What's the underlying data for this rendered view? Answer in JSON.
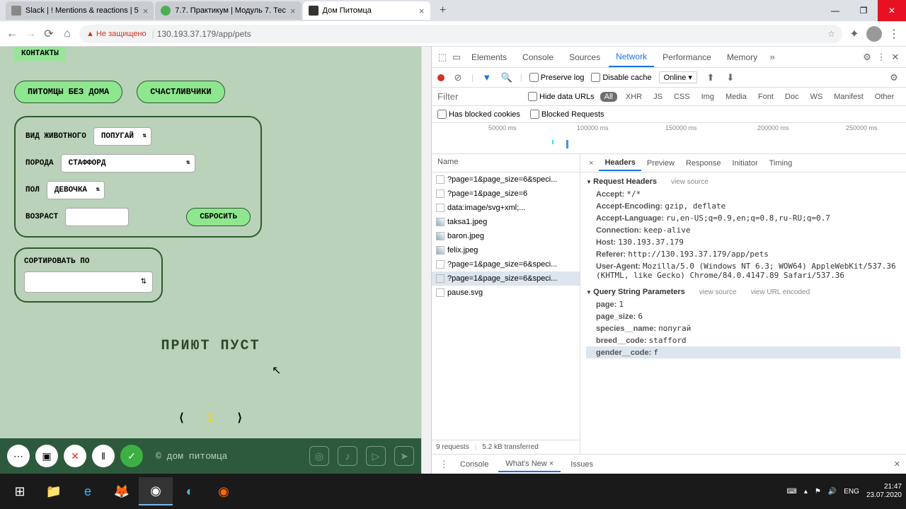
{
  "tabs": [
    {
      "title": "Slack | ! Mentions & reactions | 5"
    },
    {
      "title": "7.7. Практикум | Модуль 7. Тес"
    },
    {
      "title": "Дом Питомца"
    }
  ],
  "addressbar": {
    "warning": "Не защищено",
    "url": "130.193.37.179/app/pets"
  },
  "page": {
    "contacts": "КОНТАКТЫ",
    "btn_homeless": "ПИТОМЦЫ БЕЗ ДОМА",
    "btn_lucky": "СЧАСТЛИВЧИКИ",
    "label_species": "ВИД ЖИВОТНОГО",
    "val_species": "ПОПУГАЙ",
    "label_breed": "ПОРОДА",
    "val_breed": "СТАФФОРД",
    "label_gender": "ПОЛ",
    "val_gender": "ДЕВОЧКА",
    "label_age": "ВОЗРАСТ",
    "btn_reset": "СБРОСИТЬ",
    "label_sort": "СОРТИРОВАТЬ ПО",
    "empty": "ПРИЮТ ПУСТ",
    "pager_prev": "⟨",
    "pager_num": "1",
    "pager_next": "⟩",
    "footer_brand": "© дом питомца"
  },
  "devtools": {
    "tabs": {
      "elements": "Elements",
      "console": "Console",
      "sources": "Sources",
      "network": "Network",
      "performance": "Performance",
      "memory": "Memory"
    },
    "toolbar": {
      "preserve": "Preserve log",
      "disable": "Disable cache",
      "online": "Online"
    },
    "filter": {
      "placeholder": "Filter",
      "hide": "Hide data URLs",
      "all": "All",
      "xhr": "XHR",
      "js": "JS",
      "css": "CSS",
      "img": "Img",
      "media": "Media",
      "font": "Font",
      "doc": "Doc",
      "ws": "WS",
      "manifest": "Manifest",
      "other": "Other"
    },
    "cookies": {
      "blocked": "Has blocked cookies",
      "requests": "Blocked Requests"
    },
    "timeline": {
      "t1": "50000 ms",
      "t2": "100000 ms",
      "t3": "150000 ms",
      "t4": "200000 ms",
      "t5": "250000 ms"
    },
    "reqhead": "Name",
    "requests": [
      "?page=1&page_size=6&speci...",
      "?page=1&page_size=6",
      "data:image/svg+xml;...",
      "taksa1.jpeg",
      "baron.jpeg",
      "felix.jpeg",
      "?page=1&page_size=6&speci...",
      "?page=1&page_size=6&speci...",
      "pause.svg"
    ],
    "status": {
      "count": "9 requests",
      "size": "5.2 kB transferred"
    },
    "detail_tabs": {
      "headers": "Headers",
      "preview": "Preview",
      "response": "Response",
      "initiator": "Initiator",
      "timing": "Timing"
    },
    "sections": {
      "reqhdr": "Request Headers",
      "qsp": "Query String Parameters",
      "viewsrc": "view source",
      "viewurl": "view URL encoded"
    },
    "headers": [
      {
        "k": "Accept:",
        "v": "*/*"
      },
      {
        "k": "Accept-Encoding:",
        "v": "gzip, deflate"
      },
      {
        "k": "Accept-Language:",
        "v": "ru,en-US;q=0.9,en;q=0.8,ru-RU;q=0.7"
      },
      {
        "k": "Connection:",
        "v": "keep-alive"
      },
      {
        "k": "Host:",
        "v": "130.193.37.179"
      },
      {
        "k": "Referer:",
        "v": "http://130.193.37.179/app/pets"
      },
      {
        "k": "User-Agent:",
        "v": "Mozilla/5.0 (Windows NT 6.3; WOW64) AppleWebKit/537.36 (KHTML, like Gecko) Chrome/84.0.4147.89 Safari/537.36"
      }
    ],
    "params": [
      {
        "k": "page:",
        "v": "1"
      },
      {
        "k": "page_size:",
        "v": "6"
      },
      {
        "k": "species__name:",
        "v": "попугай"
      },
      {
        "k": "breed__code:",
        "v": "stafford"
      },
      {
        "k": "gender__code:",
        "v": "f"
      }
    ],
    "drawer": {
      "console": "Console",
      "whatsnew": "What's New",
      "issues": "Issues"
    }
  },
  "tray": {
    "lang": "ENG",
    "time": "21:47",
    "date": "23.07.2020"
  }
}
